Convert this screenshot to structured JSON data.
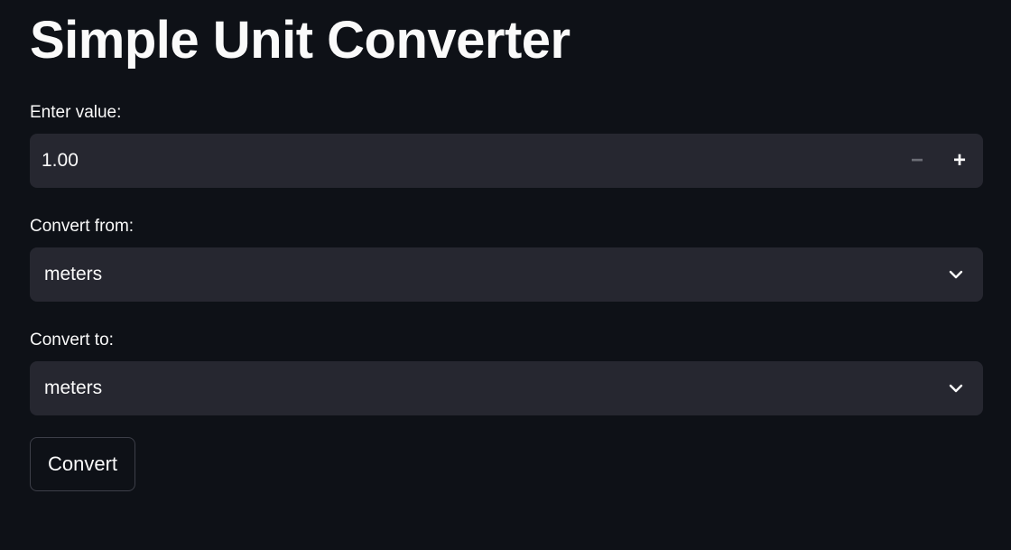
{
  "page": {
    "title": "Simple Unit Converter"
  },
  "value_input": {
    "label": "Enter value:",
    "value": "1.00",
    "decrement_symbol": "−",
    "increment_symbol": "+"
  },
  "from_select": {
    "label": "Convert from:",
    "selected": "meters",
    "icon": "chevron-down-icon"
  },
  "to_select": {
    "label": "Convert to:",
    "selected": "meters",
    "icon": "chevron-down-icon"
  },
  "convert_button": {
    "label": "Convert"
  },
  "colors": {
    "background": "#0e1117",
    "field_background": "#262730",
    "text": "#fafafa",
    "muted": "#6b6d75",
    "button_border": "#3d3f49"
  }
}
